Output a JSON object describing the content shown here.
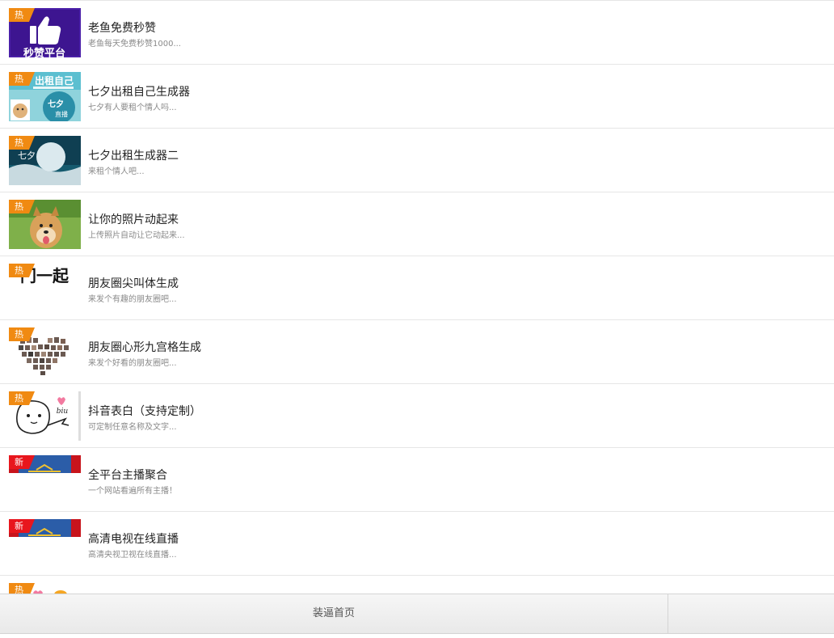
{
  "items": [
    {
      "badge": "热",
      "badge_type": "hot",
      "title": "老鱼免费秒赞",
      "desc": "老鱼每天免费秒赞1000...",
      "thumb_text": "秒赞平台"
    },
    {
      "badge": "热",
      "badge_type": "hot",
      "title": "七夕出租自己生成器",
      "desc": "七夕有人要租个情人吗...",
      "thumb_text": "出租自己",
      "thumb_text2": "七夕",
      "thumb_text3": "直播"
    },
    {
      "badge": "热",
      "badge_type": "hot",
      "title": "七夕出租生成器二",
      "desc": "来租个情人吧...",
      "thumb_text": "七夕"
    },
    {
      "badge": "热",
      "badge_type": "hot",
      "title": "让你的照片动起来",
      "desc": "上传照片自动让它动起来..."
    },
    {
      "badge": "热",
      "badge_type": "hot",
      "title": "朋友圈尖叫体生成",
      "desc": "来发个有趣的朋友圈吧...",
      "thumb_text": "门一起"
    },
    {
      "badge": "热",
      "badge_type": "hot",
      "title": "朋友圈心形九宫格生成",
      "desc": "来发个好看的朋友圈吧..."
    },
    {
      "badge": "热",
      "badge_type": "hot",
      "title": "抖音表白（支持定制）",
      "desc": "可定制任意名称及文字...",
      "thumb_text": "biu"
    },
    {
      "badge": "新",
      "badge_type": "new",
      "title": "全平台主播聚合",
      "desc": "一个网站看遍所有主播！"
    },
    {
      "badge": "新",
      "badge_type": "new",
      "title": "高清电视在线直播",
      "desc": "高清央视卫视在线直播..."
    },
    {
      "badge": "热",
      "badge_type": "hot",
      "title": "",
      "desc": ""
    }
  ],
  "footer": {
    "home_label": "装逼首页"
  },
  "colors": {
    "hot_badge": "#f08a12",
    "new_badge": "#e8161d",
    "divider": "#e6e6e6"
  }
}
